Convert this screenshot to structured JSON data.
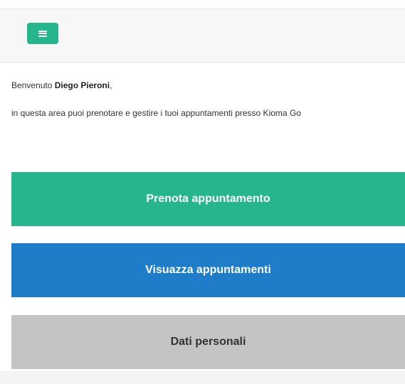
{
  "header": {
    "menu_icon": "hamburger-icon",
    "accent_color": "#26b58c"
  },
  "welcome": {
    "greeting": "Benvenuto",
    "user_name": "Diego Pieroni",
    "punctuation": ",",
    "intro_text": "in questa area puoi prenotare e gestire i tuoi appuntamenti presso Kioma Go"
  },
  "actions": {
    "book_label": "Prenota appuntamento",
    "view_label": "Visuazza appuntamenti",
    "personal_label": "Dati personali"
  },
  "colors": {
    "book": "#26b58c",
    "view": "#1e7cc8",
    "personal": "#c4c4c4"
  }
}
